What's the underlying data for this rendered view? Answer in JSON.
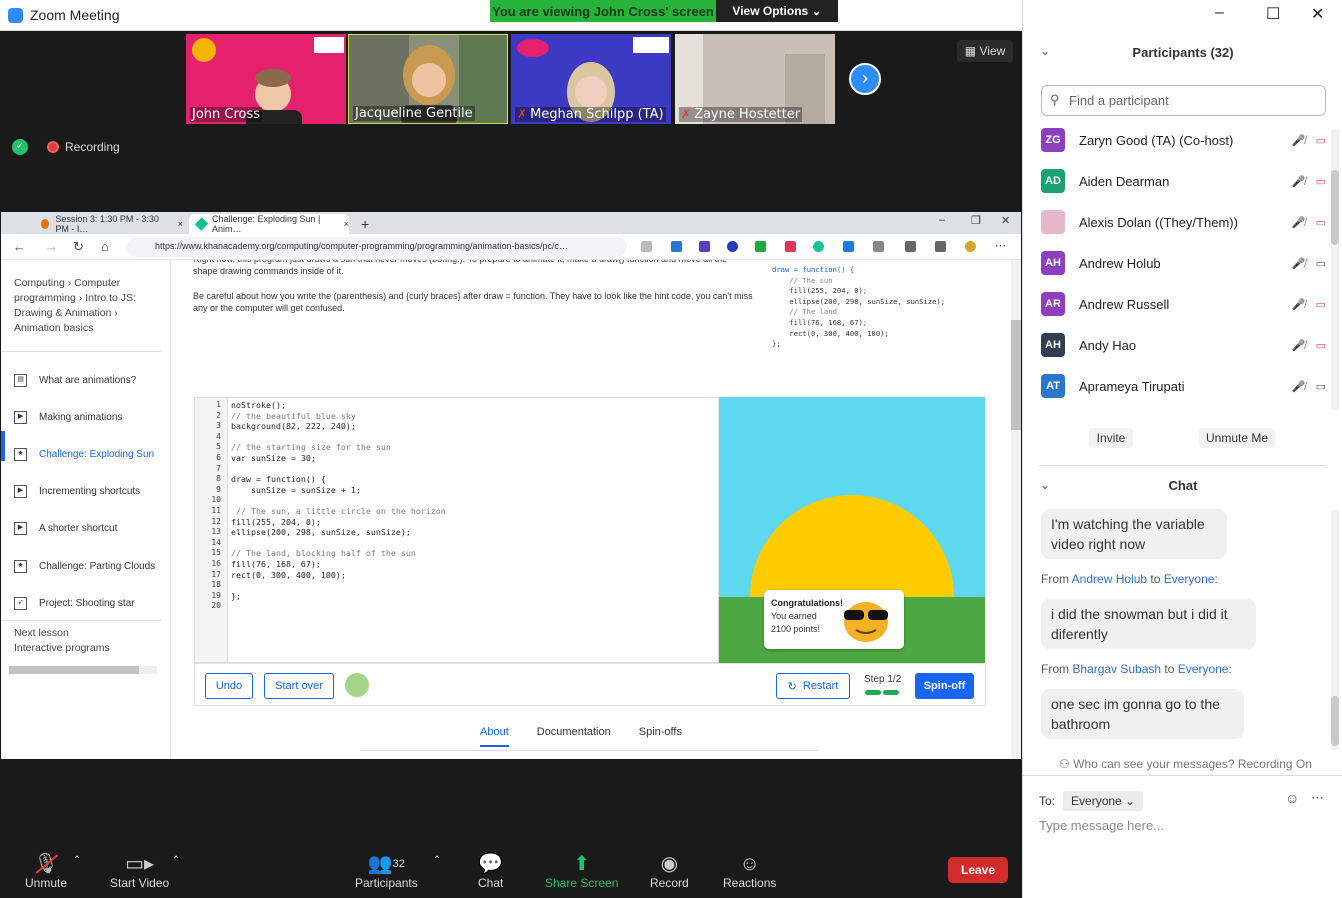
{
  "app": {
    "title": "Zoom Meeting"
  },
  "banner": {
    "viewing": "You are viewing John Cross' screen",
    "view_options": "View Options"
  },
  "gallery": {
    "tiles": [
      {
        "name": "John Cross",
        "muted": false
      },
      {
        "name": "Jacqueline Gentile",
        "muted": false
      },
      {
        "name": "Meghan Schilpp (TA)",
        "muted": true
      },
      {
        "name": "Zayne Hostetter",
        "muted": true
      }
    ],
    "view_label": "View",
    "iup_badge": "IUP"
  },
  "status": {
    "recording": "Recording"
  },
  "browser": {
    "tabs": [
      {
        "label": "Session 3: 1:30 PM - 3:30 PM - I…"
      },
      {
        "label": "Challenge: Exploding Sun | Anim…"
      }
    ],
    "url": "https://www.khanacademy.org/computing/computer-programming/programming/animation-basics/pc/c…"
  },
  "khan": {
    "breadcrumbs": [
      "Computing",
      "Computer programming",
      "Intro to JS: Drawing & Animation",
      "Animation basics"
    ],
    "lessons": [
      {
        "label": "What are animations?",
        "icon": "doc",
        "done": true
      },
      {
        "label": "Making animations",
        "icon": "play",
        "done": false
      },
      {
        "label": "Challenge: Exploding Sun",
        "icon": "star",
        "done": true,
        "current": true
      },
      {
        "label": "Incrementing shortcuts",
        "icon": "play",
        "done": false
      },
      {
        "label": "A shorter shortcut",
        "icon": "play",
        "done": false
      },
      {
        "label": "Challenge: Parting Clouds",
        "icon": "star",
        "done": false
      },
      {
        "label": "Project: Shooting star",
        "icon": "rocket",
        "done": false
      }
    ],
    "next_lesson_label": "Next lesson",
    "next_lesson": "Interactive programs",
    "desc_partial": "Right now, this program just draws a sun that never moves (boring!). To prepare to animate it, make a draw() function and move all the shape drawing commands inside of it.",
    "desc2": "Be careful about how you write the (parenthesis) and {curly braces} after draw = function. They have to look like the hint code, you can't miss any or the computer will get confused.",
    "hint_code": [
      "draw = function() {",
      "    // The sun",
      "    fill(255, 204, 0);",
      "    ellipse(200, 298, sunSize, sunSize);",
      "",
      "    // The land",
      "    fill(76, 168, 67);",
      "    rect(0, 300, 400, 100);",
      "};"
    ],
    "code": [
      "noStroke();",
      "// the beautiful blue sky",
      "background(82, 222, 240);",
      "",
      "// the starting size for the sun",
      "var sunSize = 30;",
      "",
      "draw = function() {",
      "    sunSize = sunSize + 1;",
      "",
      " // The sun, a little circle on the horizon",
      "fill(255, 204, 0);",
      "ellipse(200, 298, sunSize, sunSize);",
      "",
      "// The land, blocking half of the sun",
      "fill(76, 168, 67);",
      "rect(0, 300, 400, 100);",
      "",
      "};",
      ""
    ],
    "toast": {
      "title": "Congratulations!",
      "line1": "You earned",
      "line2": "2100 points!"
    },
    "buttons": {
      "undo": "Undo",
      "start_over": "Start over",
      "restart": "Restart",
      "step": "Step 1/2",
      "spinoff": "Spin-off"
    },
    "page_tabs": [
      "About",
      "Documentation",
      "Spin-offs"
    ],
    "colors": {
      "sky": "#52def0",
      "sun": "#ffcc00",
      "land": "#4ca843",
      "accent": "#1865f2"
    }
  },
  "toolbar": {
    "unmute": "Unmute",
    "start_video": "Start Video",
    "participants": "Participants",
    "participant_count": "32",
    "chat": "Chat",
    "share_screen": "Share Screen",
    "record": "Record",
    "reactions": "Reactions",
    "leave": "Leave"
  },
  "participants": {
    "title": "Participants (32)",
    "search_placeholder": "Find a participant",
    "list": [
      {
        "initials": "ZG",
        "name": "Zaryn Good (TA) (Co-host)",
        "color": "#8e3fc0",
        "video": false
      },
      {
        "initials": "AD",
        "name": "Aiden Dearman",
        "color": "#1aa36e",
        "video": false
      },
      {
        "initials": "",
        "name": "Alexis Dolan ((They/Them))",
        "color": "#e6b7c8",
        "video": false
      },
      {
        "initials": "AH",
        "name": "Andrew Holub",
        "color": "#8e3fc0",
        "video": true
      },
      {
        "initials": "AR",
        "name": "Andrew Russell",
        "color": "#8e3fc0",
        "video": false
      },
      {
        "initials": "AH",
        "name": "Andy Hao",
        "color": "#2f3e52",
        "video": false
      },
      {
        "initials": "AT",
        "name": "Aprameya Tirupati",
        "color": "#2879c9",
        "video": true
      }
    ],
    "invite": "Invite",
    "unmute_me": "Unmute Me"
  },
  "chat": {
    "title": "Chat",
    "messages": [
      {
        "from": "",
        "to": "",
        "text_lines": [
          "I'm watching the variable",
          "video right now"
        ]
      },
      {
        "from": "Andrew Holub",
        "to": "Everyone",
        "text_lines": [
          "i did the snowman but i did it",
          "diferently"
        ]
      },
      {
        "from": "Bhargav Subash",
        "to": "Everyone",
        "text_lines": [
          "one sec im gonna go to the",
          "bathroom"
        ]
      }
    ],
    "from_label": "From",
    "to_label": "to",
    "who_can_see": "Who can see your messages? Recording On",
    "to_prefix": "To:",
    "to_value": "Everyone",
    "placeholder": "Type message here..."
  }
}
